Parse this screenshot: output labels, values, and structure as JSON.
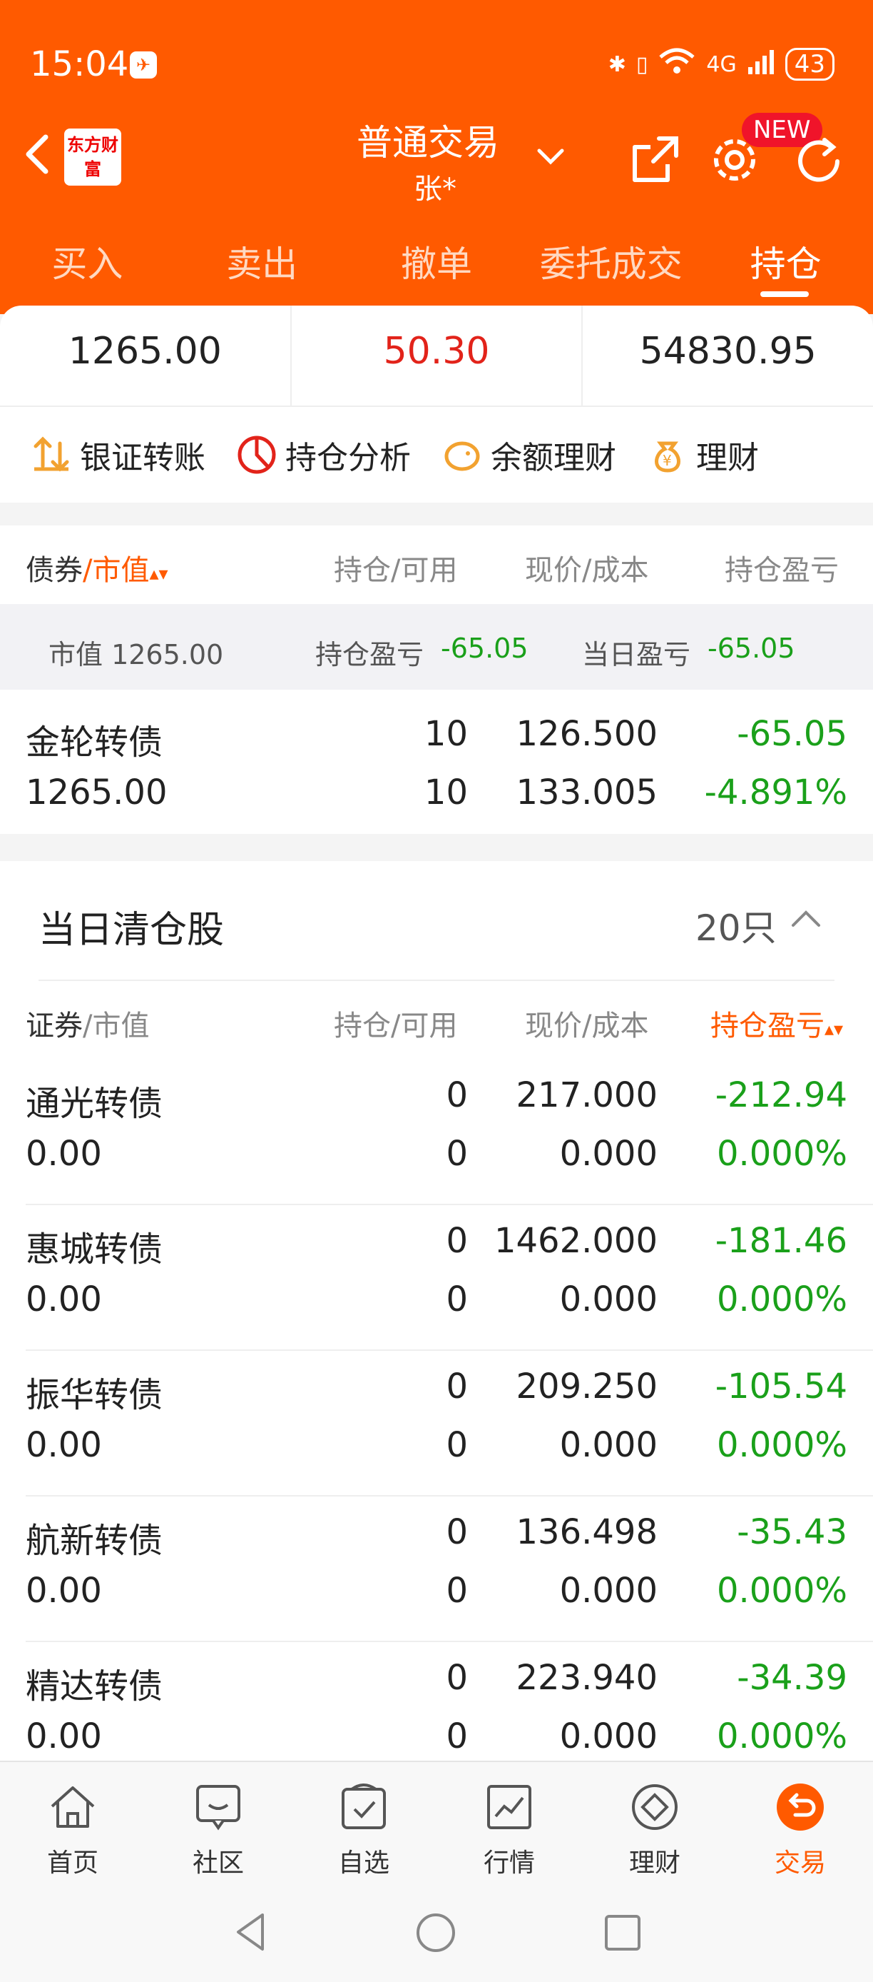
{
  "status": {
    "time": "15:04",
    "battery": "43",
    "network": "4G"
  },
  "header": {
    "logo": "东方财富",
    "title": "普通交易",
    "account": "张*",
    "new_badge": "NEW"
  },
  "tabs": [
    "买入",
    "卖出",
    "撤单",
    "委托成交",
    "持仓"
  ],
  "summary": [
    "1265.00",
    "50.30",
    "54830.95"
  ],
  "quick_actions": [
    "银证转账",
    "持仓分析",
    "余额理财",
    "理财"
  ],
  "holdings": {
    "header": {
      "name": "债券",
      "sep": "/",
      "sort": "市值",
      "qty": "持仓/可用",
      "price": "现价/成本",
      "pnl": "持仓盈亏"
    },
    "sub": {
      "mv_label": "市值 1265.00",
      "pos_label": "持仓盈亏",
      "pos_value": "-65.05",
      "day_label": "当日盈亏",
      "day_value": "-65.05"
    },
    "rows": [
      {
        "name": "金轮转债",
        "mv": "1265.00",
        "qty": "10",
        "avail": "10",
        "price": "126.500",
        "cost": "133.005",
        "pnl": "-65.05",
        "pct": "-4.891%"
      }
    ]
  },
  "cleared": {
    "title": "当日清仓股",
    "count": "20只",
    "header": {
      "name": "证券",
      "sep": "/",
      "mv": "市值",
      "qty": "持仓/可用",
      "price": "现价/成本",
      "pnl": "持仓盈亏"
    },
    "rows": [
      {
        "name": "通光转债",
        "mv": "0.00",
        "qty": "0",
        "avail": "0",
        "price": "217.000",
        "cost": "0.000",
        "pnl": "-212.94",
        "pct": "0.000%"
      },
      {
        "name": "惠城转债",
        "mv": "0.00",
        "qty": "0",
        "avail": "0",
        "price": "1462.000",
        "cost": "0.000",
        "pnl": "-181.46",
        "pct": "0.000%"
      },
      {
        "name": "振华转债",
        "mv": "0.00",
        "qty": "0",
        "avail": "0",
        "price": "209.250",
        "cost": "0.000",
        "pnl": "-105.54",
        "pct": "0.000%"
      },
      {
        "name": "航新转债",
        "mv": "0.00",
        "qty": "0",
        "avail": "0",
        "price": "136.498",
        "cost": "0.000",
        "pnl": "-35.43",
        "pct": "0.000%"
      },
      {
        "name": "精达转债",
        "mv": "0.00",
        "qty": "0",
        "avail": "0",
        "price": "223.940",
        "cost": "0.000",
        "pnl": "-34.39",
        "pct": "0.000%"
      }
    ]
  },
  "bottom_nav": [
    "首页",
    "社区",
    "自选",
    "行情",
    "理财",
    "交易"
  ],
  "colors": {
    "brand": "#ff5a00",
    "up": "#e2231a",
    "down": "#1aa01a"
  }
}
